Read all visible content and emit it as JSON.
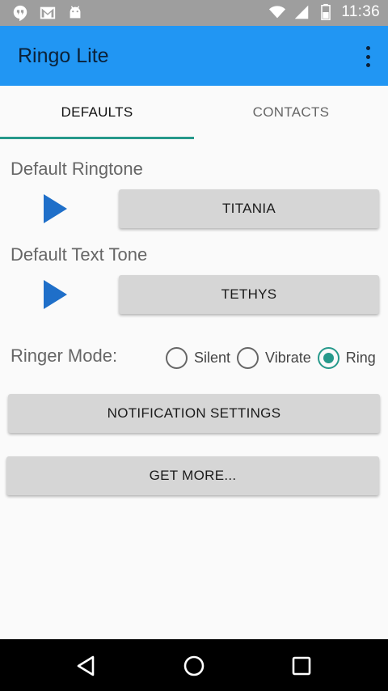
{
  "status_bar": {
    "time": "11:36",
    "icons_left": [
      "hangouts-icon",
      "gmail-icon",
      "android-icon"
    ],
    "icons_right": [
      "wifi-icon",
      "signal-icon",
      "battery-icon"
    ]
  },
  "app_bar": {
    "title": "Ringo Lite"
  },
  "tabs": [
    {
      "label": "DEFAULTS",
      "active": true
    },
    {
      "label": "CONTACTS",
      "active": false
    }
  ],
  "defaults": {
    "ringtone": {
      "label": "Default Ringtone",
      "value": "TITANIA"
    },
    "text_tone": {
      "label": "Default Text Tone",
      "value": "TETHYS"
    },
    "ringer_mode": {
      "label": "Ringer Mode:",
      "options": [
        "Silent",
        "Vibrate",
        "Ring"
      ],
      "selected": "Ring"
    },
    "notification_button": "NOTIFICATION SETTINGS",
    "get_more_button": "GET MORE..."
  },
  "colors": {
    "app_bar": "#2196f3",
    "accent": "#26998b",
    "play": "#1f6fc9",
    "status_bar": "#9e9e9e"
  },
  "nav_bar": [
    "back-icon",
    "home-icon",
    "recents-icon"
  ]
}
